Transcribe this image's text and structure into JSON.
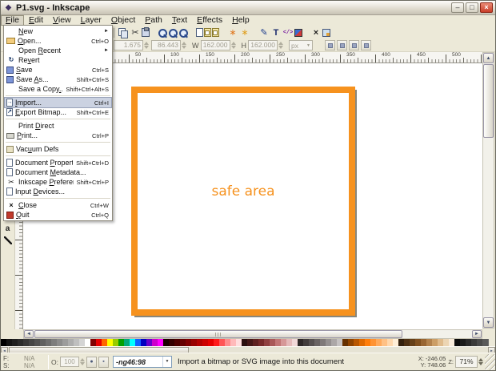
{
  "window": {
    "title": "P1.svg - Inkscape"
  },
  "titlebar": {
    "buttons": {
      "minimize": "–",
      "maximize": "□",
      "close": "×"
    }
  },
  "icons": {
    "up": "▲",
    "down": "▼",
    "left": "◄",
    "right": "►",
    "dropdown": "▼",
    "app_logo": "◆"
  },
  "menubar": {
    "active": "File",
    "items": [
      {
        "label": "File",
        "accel": 0
      },
      {
        "label": "Edit",
        "accel": 0
      },
      {
        "label": "View",
        "accel": 0
      },
      {
        "label": "Layer",
        "accel": 0
      },
      {
        "label": "Object",
        "accel": 0
      },
      {
        "label": "Path",
        "accel": 0
      },
      {
        "label": "Text",
        "accel": 0
      },
      {
        "label": "Effects",
        "accel": 0
      },
      {
        "label": "Help",
        "accel": 0
      }
    ]
  },
  "file_menu": {
    "icon_glyphs": {
      "revert": "↻",
      "import": "→",
      "export": "↗",
      "preferences": "✂",
      "close": "×"
    },
    "items": [
      {
        "label": "New",
        "accel": 0,
        "submenu": true
      },
      {
        "label": "Open...",
        "accel": 0,
        "shortcut": "Ctrl+O",
        "icon": "open"
      },
      {
        "label": "Open Recent",
        "accel": 5,
        "submenu": true
      },
      {
        "label": "Revert",
        "accel": 2,
        "icon": "revert"
      },
      {
        "label": "Save",
        "accel": 0,
        "shortcut": "Ctrl+S",
        "icon": "save"
      },
      {
        "label": "Save As...",
        "accel": 5,
        "shortcut": "Shift+Ctrl+S",
        "icon": "save-as"
      },
      {
        "label": "Save a Copy...",
        "accel": 11,
        "shortcut": "Shift+Ctrl+Alt+S"
      },
      {
        "separator": true
      },
      {
        "label": "Import...",
        "accel": 0,
        "shortcut": "Ctrl+I",
        "icon": "import",
        "highlighted": true
      },
      {
        "label": "Export Bitmap...",
        "accel": 0,
        "shortcut": "Shift+Ctrl+E",
        "icon": "export"
      },
      {
        "separator": true
      },
      {
        "label": "Print Direct",
        "accel": 6
      },
      {
        "label": "Print...",
        "accel": 0,
        "shortcut": "Ctrl+P",
        "icon": "print"
      },
      {
        "separator": true
      },
      {
        "label": "Vacuum Defs",
        "accel": 3,
        "icon": "vacuum"
      },
      {
        "separator": true
      },
      {
        "label": "Document Properties...",
        "accel": 9,
        "shortcut": "Shift+Ctrl+D",
        "icon": "doc-properties"
      },
      {
        "label": "Document Metadata...",
        "accel": 9,
        "icon": "doc-metadata"
      },
      {
        "label": "Inkscape Preferences...",
        "accel": 9,
        "shortcut": "Shift+Ctrl+P",
        "icon": "preferences"
      },
      {
        "label": "Input Devices...",
        "accel": 6,
        "icon": "input-devices"
      },
      {
        "separator": true
      },
      {
        "label": "Close",
        "accel": 0,
        "shortcut": "Ctrl+W",
        "icon": "close"
      },
      {
        "label": "Quit",
        "accel": 0,
        "shortcut": "Ctrl+Q",
        "icon": "quit"
      }
    ]
  },
  "toolbar": {
    "icons": [
      {
        "name": "copy-icon",
        "shape": "pages"
      },
      {
        "name": "cut-icon",
        "shape": "glyph",
        "glyph": "✂",
        "color": "#333333"
      },
      {
        "name": "paste-icon",
        "shape": "clipboard"
      },
      {
        "name": "zoom-drawing-icon",
        "shape": "mag",
        "gap": true
      },
      {
        "name": "zoom-selection-icon",
        "shape": "mag"
      },
      {
        "name": "zoom-page-icon",
        "shape": "mag"
      },
      {
        "name": "duplicate-icon",
        "shape": "page-blue",
        "gap": true
      },
      {
        "name": "clone-icon",
        "shape": "page-yellow"
      },
      {
        "name": "unlink-clone-icon",
        "shape": "page-yellow"
      },
      {
        "name": "group-icon",
        "shape": "glyph",
        "glyph": "∗",
        "color": "#e07820",
        "gap": true
      },
      {
        "name": "ungroup-icon",
        "shape": "glyph",
        "glyph": "∗",
        "color": "#e0a020"
      },
      {
        "name": "pen-icon",
        "shape": "glyph",
        "glyph": "✎",
        "color": "#1a3a8c",
        "gap": true
      },
      {
        "name": "text-dialog-icon",
        "shape": "glyph",
        "glyph": "T",
        "color": "#1a2a6c",
        "bold": true
      },
      {
        "name": "xml-editor-icon",
        "shape": "xml",
        "glyph": "</>"
      },
      {
        "name": "fill-stroke-icon",
        "shape": "fills"
      },
      {
        "name": "preferences-icon",
        "shape": "glyph",
        "glyph": "×",
        "color": "#222222",
        "bold": true,
        "gap": true
      },
      {
        "name": "about-icon",
        "shape": "frame"
      }
    ]
  },
  "tool_options": {
    "fields": [
      {
        "label": "",
        "value": "1.675",
        "name": "x-field"
      },
      {
        "label": "",
        "value": "86.443",
        "name": "y-field"
      },
      {
        "label": "W",
        "value": "162.000",
        "name": "width-field"
      },
      {
        "label": "H",
        "value": "162.000",
        "name": "height-field"
      }
    ],
    "unit": "px",
    "buttons": [
      {
        "name": "affect-button-1"
      },
      {
        "name": "affect-button-2"
      },
      {
        "name": "affect-button-3"
      },
      {
        "name": "affect-button-4"
      }
    ]
  },
  "toolbox": {
    "tools": [
      {
        "name": "text-tool-icon",
        "glyph": "a"
      },
      {
        "name": "dropper-tool-icon",
        "glyph": ""
      }
    ]
  },
  "rulers": {
    "horizontal_labels": [
      "50",
      "100",
      "150",
      "200",
      "250",
      "300",
      "350",
      "400",
      "450",
      "500"
    ]
  },
  "canvas": {
    "safe_area_label": "safe area",
    "square_color": "#f6921e"
  },
  "palette": {
    "colors": [
      "#000000",
      "#141414",
      "#1f1f1f",
      "#2b2b2b",
      "#383838",
      "#454545",
      "#525252",
      "#606060",
      "#6e6e6e",
      "#7d7d7d",
      "#8c8c8c",
      "#9c9c9c",
      "#adadad",
      "#bfbfbf",
      "#d4d4d4",
      "#ffffff",
      "#800000",
      "#e60000",
      "#ff6600",
      "#ffff00",
      "#99cc00",
      "#00a000",
      "#00a878",
      "#00ffff",
      "#1060ff",
      "#0000c0",
      "#6600cc",
      "#cc00cc",
      "#ff00ff",
      "#1a0000",
      "#330000",
      "#4d0000",
      "#660000",
      "#800000",
      "#990000",
      "#b30000",
      "#cc0000",
      "#e60000",
      "#ff1a1a",
      "#ff5555",
      "#ff8c8c",
      "#ffbaba",
      "#ffdede",
      "#2b0f0f",
      "#451717",
      "#5e2020",
      "#772a2a",
      "#904040",
      "#a95858",
      "#c27676",
      "#d69898",
      "#e5baba",
      "#f1d8d8",
      "#2e2828",
      "#423c3c",
      "#565050",
      "#6a6464",
      "#7f7979",
      "#959090",
      "#aca7a7",
      "#c6c2c2",
      "#663000",
      "#8f4300",
      "#b85600",
      "#e06900",
      "#ff7d0a",
      "#ff9333",
      "#ffaa5c",
      "#ffc185",
      "#ffd8ad",
      "#ffeed6",
      "#33200d",
      "#4d3013",
      "#664019",
      "#805020",
      "#996633",
      "#b3824d",
      "#cc9e66",
      "#dfbb8c",
      "#ecd5b3",
      "#f7ead9",
      "#0a0a0a",
      "#1a1a1a",
      "#2a2a2a",
      "#3a3a3a",
      "#4a4a4a",
      "#5a5a5a",
      "#6a6a6a"
    ]
  },
  "statusbar": {
    "fill_label": "F:",
    "fill_value": "N/A",
    "stroke_label": "S:",
    "stroke_value": "N/A",
    "opacity_label": "O:",
    "opacity_value": "100",
    "layer_value": "-ng46:98",
    "message": "Import a bitmap or SVG image into this document",
    "x_label": "X:",
    "x_value": "-246.05",
    "y_label": "Y:",
    "y_value": "748.06",
    "zoom_label": "Z:",
    "zoom_value": "71%"
  }
}
